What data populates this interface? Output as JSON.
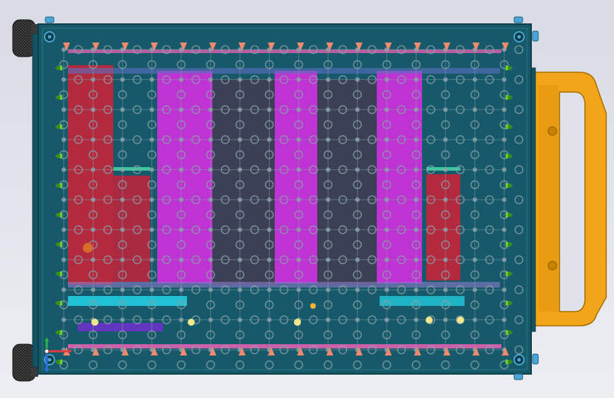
{
  "viewport": {
    "background": "#dfe1e8"
  },
  "assembly": {
    "plate_color": "#15596a",
    "plate_edge_color": "#0e3e4a",
    "grid_overlay_color": "#8aa2aa",
    "grid_cols": 15,
    "grid_rows": 10,
    "handle_color": "#f2a518",
    "knob_color": "#2b2b2b",
    "mount_hole_color": "#4aa6d6",
    "side_pin_color": "#6ad12f",
    "top_pin_color": "#f08a6e",
    "bottom_pin_color": "#f08a6e",
    "regions": [
      {
        "name": "red-block-left",
        "color": "#c4233a"
      },
      {
        "name": "magenta-block-1",
        "color": "#d12ee0"
      },
      {
        "name": "dark-block-1",
        "color": "#3e3f55"
      },
      {
        "name": "magenta-block-2",
        "color": "#d12ee0"
      },
      {
        "name": "dark-block-2",
        "color": "#3e3f55"
      },
      {
        "name": "magenta-block-3",
        "color": "#d12ee0"
      },
      {
        "name": "red-block-right",
        "color": "#c4233a"
      },
      {
        "name": "cyan-strip-left",
        "color": "#22d3e6"
      },
      {
        "name": "purple-strip-left",
        "color": "#6a32c8"
      }
    ]
  },
  "triad": {
    "x_color": "#e23b3b",
    "y_color": "#2fb34a",
    "z_color": "#2f6ee0"
  }
}
